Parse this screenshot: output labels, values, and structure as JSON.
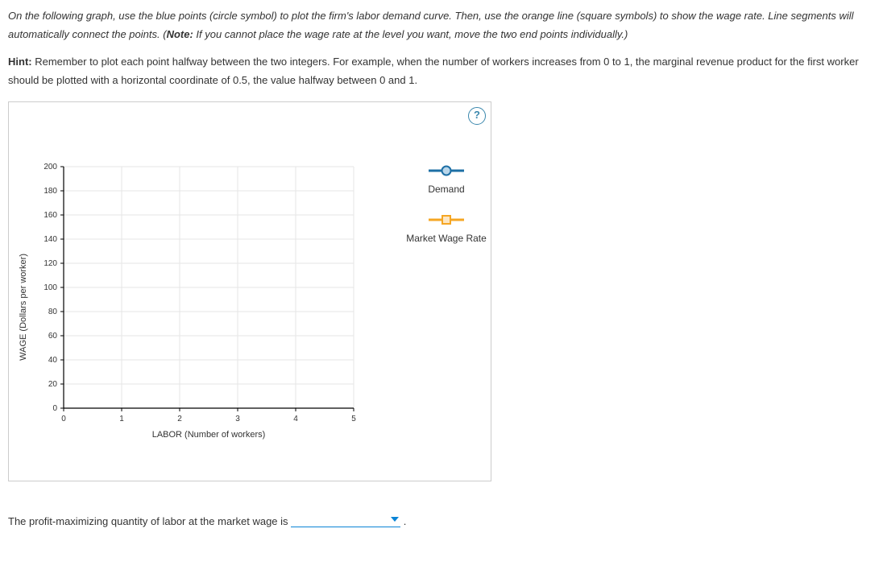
{
  "instructions": {
    "part1_italic": "On the following graph, use the blue points (circle symbol) to plot the firm's labor demand curve. Then, use the orange line (square symbols) to show the wage rate. Line segments will automatically connect the points. (",
    "note_bold": "Note:",
    "part2_italic": " If you cannot place the wage rate at the level you want, move the two end points individually.)"
  },
  "hint": {
    "label": "Hint:",
    "text": " Remember to plot each point halfway between the two integers. For example, when the number of workers increases from 0 to 1, the marginal revenue product for the first worker should be plotted with a horizontal coordinate of 0.5, the value halfway between 0 and 1."
  },
  "help_glyph": "?",
  "chart_data": {
    "type": "scatter",
    "title": "",
    "xlabel": "LABOR (Number of workers)",
    "ylabel": "WAGE (Dollars per worker)",
    "xlim": [
      0,
      5
    ],
    "ylim": [
      0,
      200
    ],
    "xticks": [
      0,
      1,
      2,
      3,
      4,
      5
    ],
    "yticks": [
      0,
      20,
      40,
      60,
      80,
      100,
      120,
      140,
      160,
      180,
      200
    ],
    "grid": true,
    "series": [
      {
        "name": "Demand",
        "symbol": "circle",
        "color": "#1d6fa5",
        "values": []
      },
      {
        "name": "Market Wage Rate",
        "symbol": "square",
        "color": "#f5a623",
        "values": []
      }
    ]
  },
  "legend": {
    "demand": "Demand",
    "wage": "Market Wage Rate"
  },
  "question": {
    "text": "The profit-maximizing quantity of labor at the market wage is ",
    "after": "."
  }
}
